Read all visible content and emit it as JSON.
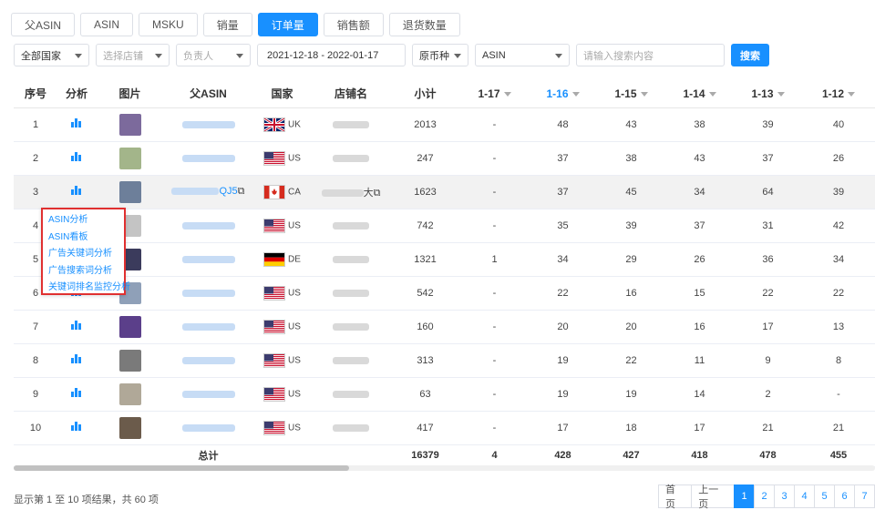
{
  "tabs": [
    "父ASIN",
    "ASIN",
    "MSKU",
    "销量",
    "订单量",
    "销售额",
    "退货数量"
  ],
  "filters": {
    "country": "全部国家",
    "store_placeholder": "选择店铺",
    "owner_placeholder": "负责人",
    "date_range": "2021-12-18 - 2022-01-17",
    "currency": "原币种",
    "search_type": "ASIN",
    "search_placeholder": "请输入搜索内容",
    "search_button": "搜索"
  },
  "table": {
    "headers": [
      "序号",
      "分析",
      "图片",
      "父ASIN",
      "国家",
      "店铺名",
      "小计",
      "1-17",
      "1-16",
      "1-15",
      "1-14",
      "1-13",
      "1-12"
    ],
    "rows": [
      {
        "no": "1",
        "country": "UK",
        "flag": "uk",
        "subtotal": "2013",
        "d": [
          "-",
          "48",
          "43",
          "38",
          "39",
          "40"
        ]
      },
      {
        "no": "2",
        "country": "US",
        "flag": "us",
        "subtotal": "247",
        "d": [
          "-",
          "37",
          "38",
          "43",
          "37",
          "26"
        ]
      },
      {
        "no": "3",
        "country": "CA",
        "flag": "ca",
        "subtotal": "1623",
        "d": [
          "-",
          "37",
          "45",
          "34",
          "64",
          "39"
        ],
        "asin_suffix": "QJ5",
        "store_suffix": "大"
      },
      {
        "no": "4",
        "country": "US",
        "flag": "us",
        "subtotal": "742",
        "d": [
          "-",
          "35",
          "39",
          "37",
          "31",
          "42"
        ]
      },
      {
        "no": "5",
        "country": "DE",
        "flag": "de",
        "subtotal": "1321",
        "d": [
          "1",
          "34",
          "29",
          "26",
          "36",
          "34"
        ]
      },
      {
        "no": "6",
        "country": "US",
        "flag": "us",
        "subtotal": "542",
        "d": [
          "-",
          "22",
          "16",
          "15",
          "22",
          "22"
        ]
      },
      {
        "no": "7",
        "country": "US",
        "flag": "us",
        "subtotal": "160",
        "d": [
          "-",
          "20",
          "20",
          "16",
          "17",
          "13"
        ]
      },
      {
        "no": "8",
        "country": "US",
        "flag": "us",
        "subtotal": "313",
        "d": [
          "-",
          "19",
          "22",
          "11",
          "9",
          "8"
        ]
      },
      {
        "no": "9",
        "country": "US",
        "flag": "us",
        "subtotal": "63",
        "d": [
          "-",
          "19",
          "19",
          "14",
          "2",
          "-"
        ]
      },
      {
        "no": "10",
        "country": "US",
        "flag": "us",
        "subtotal": "417",
        "d": [
          "-",
          "17",
          "18",
          "17",
          "21",
          "21"
        ]
      }
    ],
    "total": {
      "label": "总计",
      "subtotal": "16379",
      "d": [
        "4",
        "428",
        "427",
        "418",
        "478",
        "455"
      ]
    }
  },
  "context_menu": [
    "ASIN分析",
    "ASIN看板",
    "广告关键词分析",
    "广告搜索词分析",
    "关键词排名监控分析"
  ],
  "footer": {
    "info": "显示第 1 至 10 项结果，共 60 项",
    "first": "首页",
    "prev": "上一页",
    "pages": [
      "1",
      "2",
      "3",
      "4",
      "5",
      "6",
      "7"
    ]
  },
  "colors": {
    "accent": "#1890ff",
    "menu_border": "#e03030"
  }
}
